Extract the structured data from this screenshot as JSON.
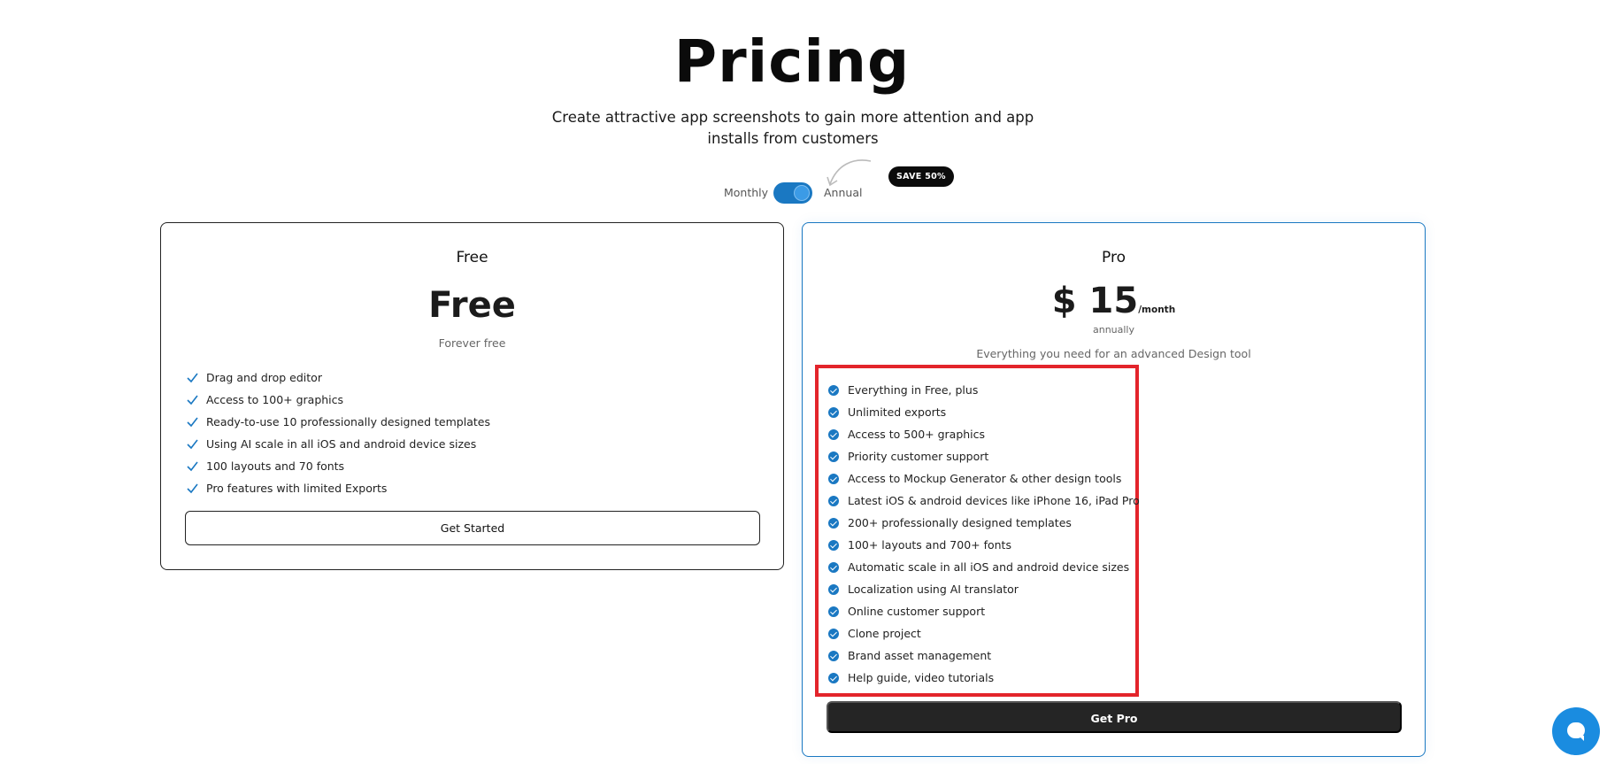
{
  "header": {
    "title": "Pricing",
    "subtitle": "Create attractive app screenshots to gain more attention and app installs from customers"
  },
  "billing_toggle": {
    "monthly_label": "Monthly",
    "annual_label": "Annual",
    "selected": "Annual",
    "badge": "SAVE 50%"
  },
  "plans": [
    {
      "name": "Free",
      "price": "Free",
      "note": "Forever free",
      "features": [
        "Drag and drop editor",
        "Access to 100+ graphics",
        "Ready-to-use 10 professionally designed templates",
        "Using AI scale in all iOS and android device sizes",
        "100 layouts and 70 fonts",
        "Pro features with limited Exports"
      ],
      "cta": "Get Started"
    },
    {
      "name": "Pro",
      "price": "$ 15",
      "price_unit": "/month",
      "billing_note": "annually",
      "description": "Everything you need for an advanced Design tool",
      "features": [
        "Everything in Free, plus",
        "Unlimited exports",
        "Access to 500+ graphics",
        "Priority customer support",
        "Access to Mockup Generator & other design tools",
        "Latest iOS & android devices like iPhone 16, iPad Pro",
        "200+ professionally designed templates",
        "100+ layouts and 700+ fonts",
        "Automatic scale in all iOS and android device sizes",
        "Localization using AI translator",
        "Online customer support",
        "Clone project",
        "Brand asset management",
        "Help guide, video tutorials"
      ],
      "cta": "Get Pro"
    }
  ],
  "colors": {
    "accent": "#1a78c2",
    "highlight_box": "#e3242b",
    "dark_button": "#252525",
    "chat_button": "#1a8ce0"
  },
  "icons": {
    "free_feature": "check-icon",
    "pro_feature": "check-circle-icon",
    "chat": "chat-bubble-icon"
  }
}
